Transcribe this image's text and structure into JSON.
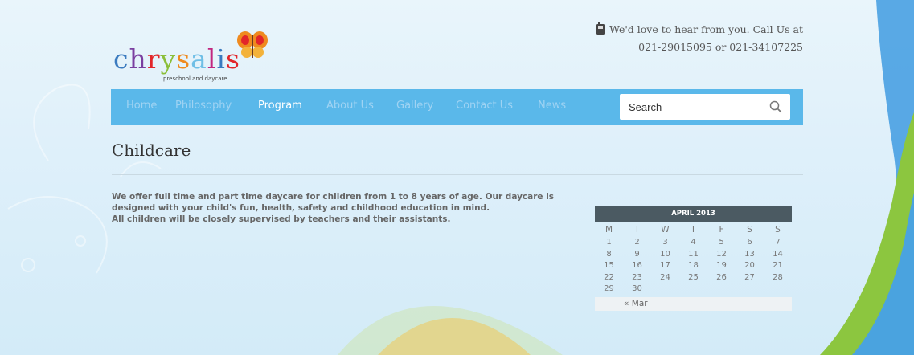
{
  "header": {
    "contact_line1": "We'd love to hear from you. Call Us at",
    "contact_line2": "021-29015095 or 021-34107225"
  },
  "logo": {
    "letters": [
      "c",
      "h",
      "r",
      "y",
      "s",
      "a",
      "l",
      "i",
      "s"
    ],
    "colors": [
      "#3b7bbf",
      "#7a3fa0",
      "#e2262a",
      "#8bbf3a",
      "#ef8a1f",
      "#6fbfe6",
      "#c2267f",
      "#3b7bbf",
      "#e2262a"
    ],
    "tagline": "preschool and daycare"
  },
  "nav": {
    "items": [
      "Home",
      "Philosophy",
      "Program",
      "About Us",
      "Gallery",
      "Contact Us",
      "News"
    ],
    "active": "Program"
  },
  "search": {
    "placeholder": "Search"
  },
  "page": {
    "title": "Childcare",
    "body_line1": "We offer full time and part time daycare for children from 1 to 8 years of age. Our daycare is",
    "body_line2": "designed with your child's fun, health, safety and childhood education in mind.",
    "body_line3": "All children will be closely supervised by teachers and their assistants."
  },
  "calendar": {
    "caption": "APRIL 2013",
    "weekdays": [
      "M",
      "T",
      "W",
      "T",
      "F",
      "S",
      "S"
    ],
    "weeks": [
      [
        "1",
        "2",
        "3",
        "4",
        "5",
        "6",
        "7"
      ],
      [
        "8",
        "9",
        "10",
        "11",
        "12",
        "13",
        "14"
      ],
      [
        "15",
        "16",
        "17",
        "18",
        "19",
        "20",
        "21"
      ],
      [
        "22",
        "23",
        "24",
        "25",
        "26",
        "27",
        "28"
      ],
      [
        "29",
        "30",
        "",
        "",
        "",
        "",
        ""
      ]
    ],
    "prev_link": "« Mar"
  },
  "colors": {
    "nav_bg": "#5ab8ea",
    "nav_active": "#ffffff",
    "nav_inactive": "#9fd3f3",
    "calendar_header": "#4b5a62"
  }
}
